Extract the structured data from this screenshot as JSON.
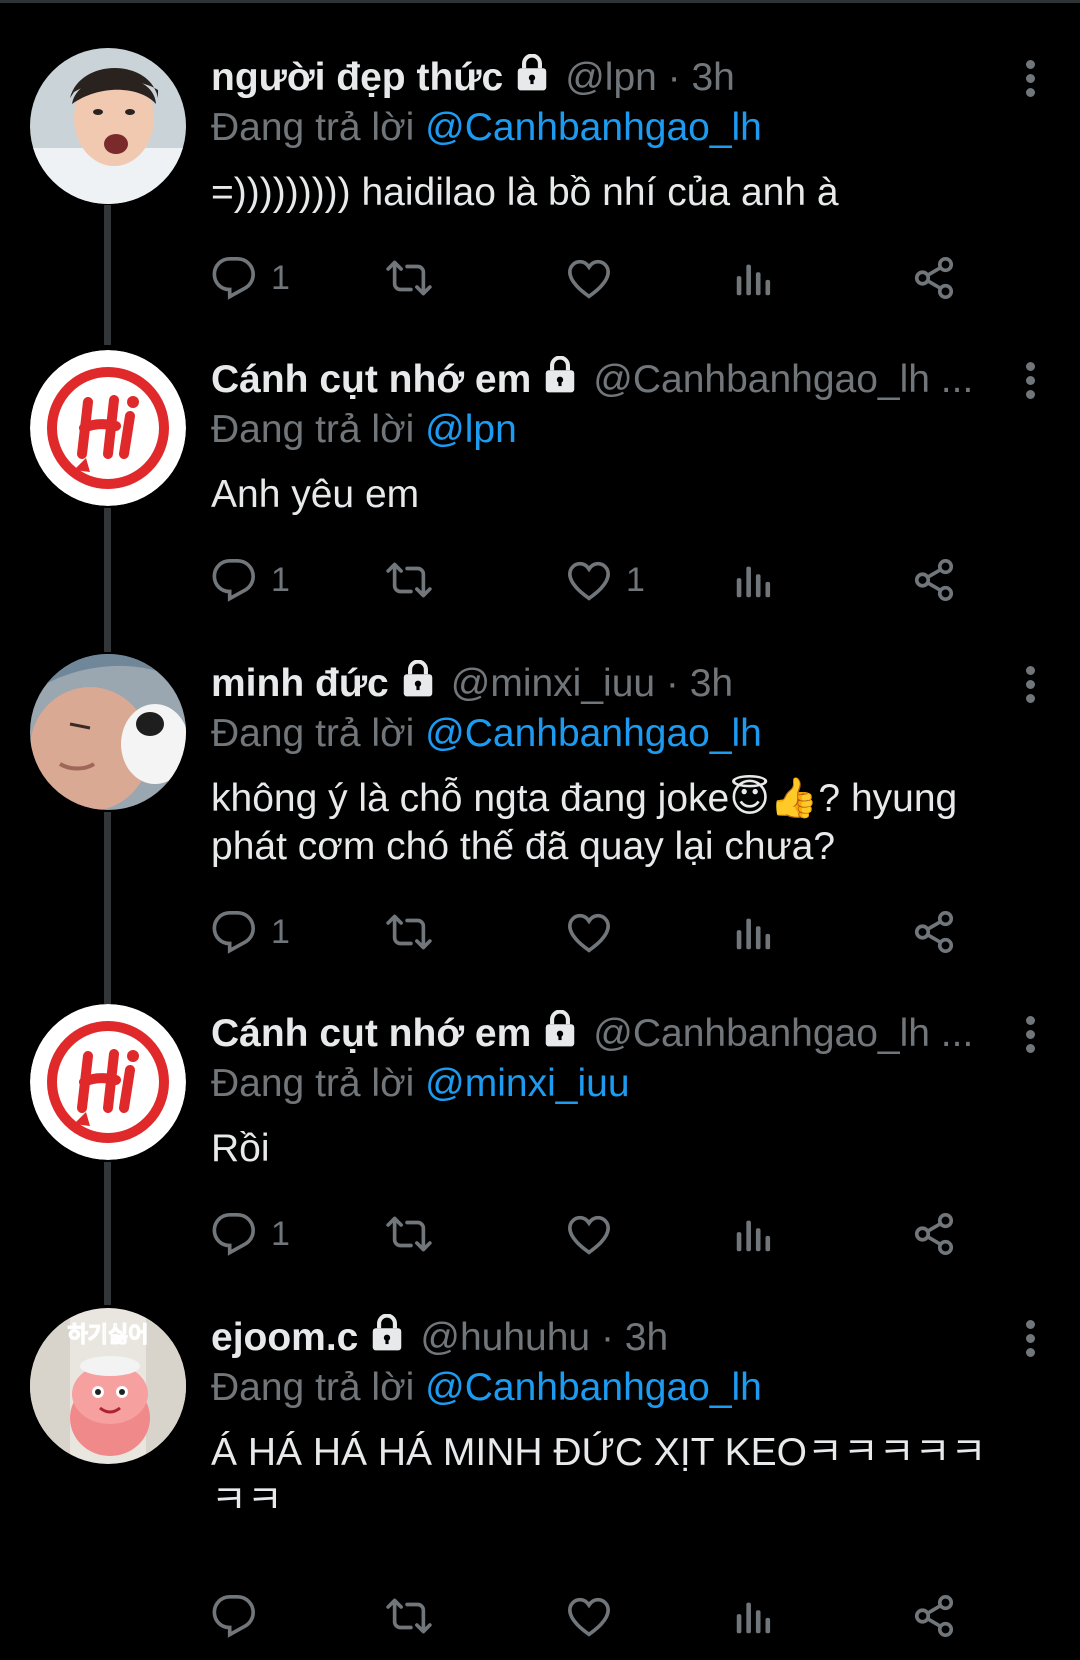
{
  "tweets": [
    {
      "name": "người đẹp thức",
      "meta": "@lpn · 3h",
      "replying_prefix": "Đang trả lời",
      "replying_to": "@Canhbanhgao_lh",
      "text": "=))))))))) haidilao là bồ nhí của anh à",
      "reply_count": "1",
      "retweet_count": "",
      "like_count": "",
      "avatar": "boy-photo"
    },
    {
      "name": "Cánh cụt nhớ em",
      "meta": "@Canhbanhgao_lh ...",
      "replying_prefix": "Đang trả lời",
      "replying_to": "@lpn",
      "text": "Anh yêu em",
      "reply_count": "1",
      "retweet_count": "",
      "like_count": "1",
      "avatar": "hi-logo"
    },
    {
      "name": "minh đức",
      "meta": "@minxi_iuu · 3h",
      "replying_prefix": "Đang trả lời",
      "replying_to": "@Canhbanhgao_lh",
      "text": "không ý là chỗ ngta đang joke😇👍? hyung phát cơm chó thế đã quay lại chưa?",
      "reply_count": "1",
      "retweet_count": "",
      "like_count": "",
      "avatar": "face-photo"
    },
    {
      "name": "Cánh cụt nhớ em",
      "meta": "@Canhbanhgao_lh ...",
      "replying_prefix": "Đang trả lời",
      "replying_to": "@minxi_iuu",
      "text": "Rồi",
      "reply_count": "1",
      "retweet_count": "",
      "like_count": "",
      "avatar": "hi-logo"
    },
    {
      "name": "ejoom.c",
      "meta": "@huhuhu · 3h",
      "replying_prefix": "Đang trả lời",
      "replying_to": "@Canhbanhgao_lh",
      "text": "Á HÁ HÁ HÁ MINH ĐỨC XỊT KEOㅋㅋㅋㅋㅋㅋㅋ",
      "reply_count": "",
      "retweet_count": "",
      "like_count": "",
      "avatar": "cartoon-sticker",
      "avatar_text": "하기싫어"
    }
  ],
  "colors": {
    "background": "#000000",
    "text": "#e7e9ea",
    "muted": "#71767b",
    "link": "#1d9bf0",
    "logo_red": "#e0292a"
  },
  "icons": [
    "lock-icon",
    "reply-icon",
    "retweet-icon",
    "like-icon",
    "views-icon",
    "share-icon",
    "more-icon"
  ]
}
